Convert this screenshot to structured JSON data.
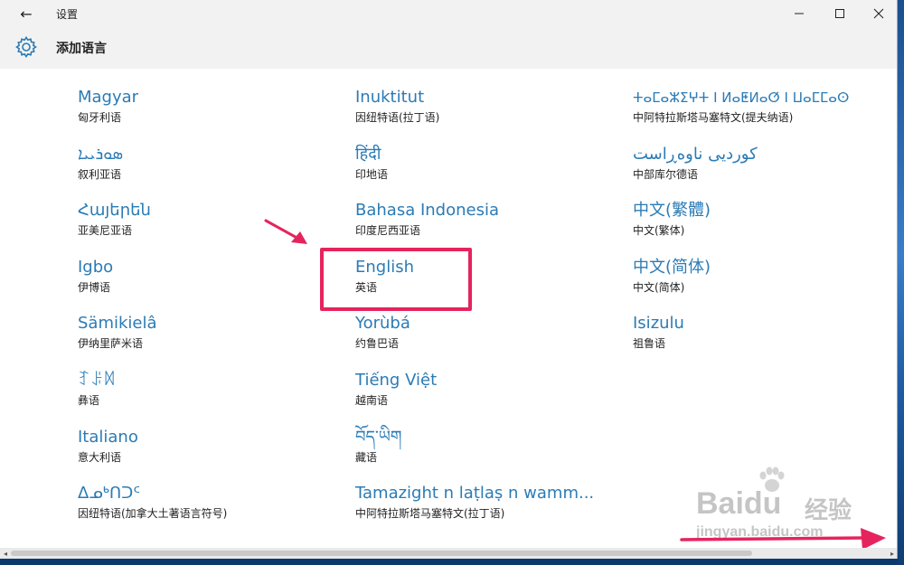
{
  "window": {
    "title": "设置",
    "back_label": "←"
  },
  "page": {
    "title": "添加语言"
  },
  "languages": [
    [
      {
        "name": "Magyar",
        "native_cn": "匈牙利语"
      },
      {
        "name": "ܣܘܪܝܝܐ",
        "native_cn": "叙利亚语"
      },
      {
        "name": "Հայերեն",
        "native_cn": "亚美尼亚语"
      },
      {
        "name": "Igbo",
        "native_cn": "伊博语"
      },
      {
        "name": "Sämikielâ",
        "native_cn": "伊纳里萨米语"
      },
      {
        "name": "ꆈꌠꉙ",
        "native_cn": "彝语"
      },
      {
        "name": "Italiano",
        "native_cn": "意大利语"
      },
      {
        "name": "ᐃᓄᒃᑎᑐᑦ",
        "native_cn": "因纽特语(加拿大土著语言符号)"
      }
    ],
    [
      {
        "name": "Inuktitut",
        "native_cn": "因纽特语(拉丁语)"
      },
      {
        "name": "हिंदी",
        "native_cn": "印地语"
      },
      {
        "name": "Bahasa Indonesia",
        "native_cn": "印度尼西亚语"
      },
      {
        "name": "English",
        "native_cn": "英语"
      },
      {
        "name": "Yorùbá",
        "native_cn": "约鲁巴语"
      },
      {
        "name": "Tiếng Việt",
        "native_cn": "越南语"
      },
      {
        "name": "བོད་ཡིག",
        "native_cn": "藏语"
      },
      {
        "name": "Tamazight n laṭlaṣ n wamm...",
        "native_cn": "中阿特拉斯塔马塞特文(拉丁语)"
      }
    ],
    [
      {
        "name": "ⵜⴰⵎⴰⵣⵉⵖⵜ ⵏ ⵍⴰⵟⵍⴰⵚ ⵏ ⵡⴰⵎⵎⴰⵙ",
        "native_cn": "中阿特拉斯塔马塞特文(提夫纳语)"
      },
      {
        "name": "کوردیی ناوەڕاست",
        "native_cn": "中部库尔德语"
      },
      {
        "name": "中文(繁體)",
        "native_cn": "中文(繁体)"
      },
      {
        "name": "中文(简体)",
        "native_cn": "中文(简体)"
      },
      {
        "name": "Isizulu",
        "native_cn": "祖鲁语"
      }
    ]
  ],
  "watermark": {
    "brand": "Baidu",
    "brand_cn": "经验",
    "url": "jingyan.baidu.com"
  },
  "colors": {
    "accent": "#2b7bb5",
    "highlight": "#e5245e"
  }
}
